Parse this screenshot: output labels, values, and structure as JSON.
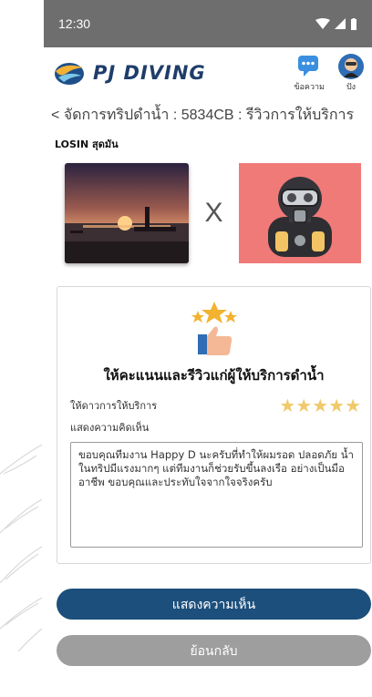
{
  "status_bar": {
    "time": "12:30"
  },
  "app": {
    "name": "PJ DIVING"
  },
  "actions": {
    "messages_label": "ข้อความ",
    "profile_label": "ปัง"
  },
  "breadcrumb": "< จัดการทริปดำน้ำ : 5834CB : รีวิวการให้บริการ",
  "reviewer": {
    "name": "LOSIN สุดมัน"
  },
  "separator": "X",
  "card": {
    "title": "ให้คะแนนและรีวิวแก่ผู้ให้บริการดำน้ำ",
    "rating_label": "ให้ดาวการให้บริการ",
    "rating_stars": "★★★★★",
    "rating_value": 5,
    "comment_label": "แสดงความคิดเห็น",
    "comment_text": "ขอบคุณทีมงาน Happy D นะครับที่ทำให้ผมรอด ปลอดภัย น้ำในทริปมีแรงมากๆ แต่ทีมงานก็ช่วยรับขึ้นลงเรือ อย่างเป็นมืออาชีพ ขอบคุณและประทับใจจากใจจริงครับ"
  },
  "buttons": {
    "submit": "แสดงความเห็น",
    "back": "ย้อนกลับ"
  },
  "colors": {
    "status_bar": "#6e6e6e",
    "brand_blue": "#1f3d6b",
    "primary_button": "#1c4f7c",
    "secondary_button": "#9e9e9e",
    "diver_background": "#f07a78",
    "star": "#f0c96a"
  }
}
